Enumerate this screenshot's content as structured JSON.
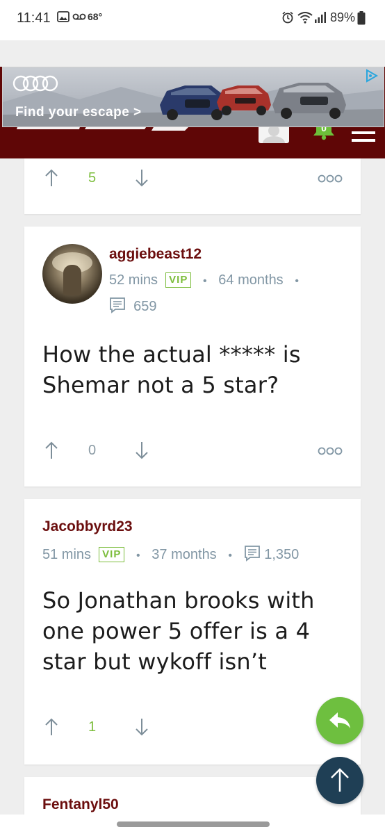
{
  "status_bar": {
    "time": "11:41",
    "temperature": "68°",
    "battery": "89%"
  },
  "ad": {
    "headline": "Find your escape >"
  },
  "header": {
    "notification_count": "0"
  },
  "posts": [
    {
      "votes": "5"
    },
    {
      "username": "aggiebeast12",
      "time_ago": "52 mins",
      "badge": "VIP",
      "membership": "64 months",
      "post_count": "659",
      "body": "How the actual ***** is Shemar not a 5 star?",
      "votes": "0"
    },
    {
      "username": "Jacobbyrd23",
      "time_ago": "51 mins",
      "badge": "VIP",
      "membership": "37 months",
      "post_count": "1,350",
      "body": "So Jonathan brooks with one power 5 offer is a 4 star but wykoff isn’t",
      "votes": "1"
    },
    {
      "username": "Fentanyl50"
    }
  ],
  "colors": {
    "maroon": "#5f0606",
    "username": "#6b0e0e",
    "green": "#7cbd3c",
    "meta": "#8196a4",
    "fab_reply": "#6ebf3f",
    "fab_top": "#1f3f55"
  },
  "icons": {
    "up_vote": "arrow-up-icon",
    "down_vote": "arrow-down-icon",
    "more": "more-options-icon",
    "messages": "message-icon",
    "reply": "reply-icon",
    "scroll_top": "arrow-up-icon"
  }
}
